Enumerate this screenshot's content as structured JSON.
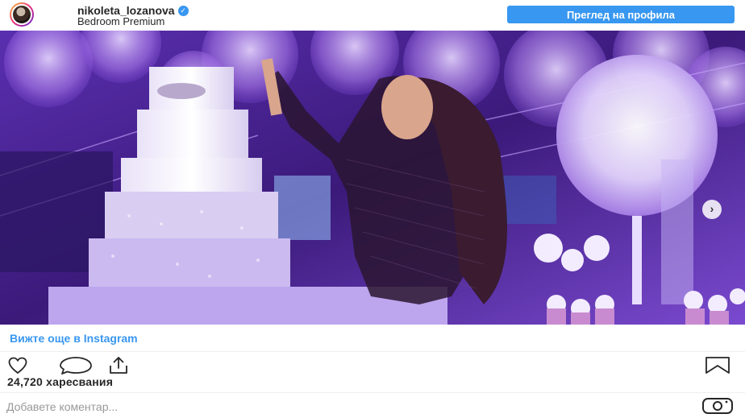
{
  "header": {
    "username": "nikoleta_lozanova",
    "verified": true,
    "location": "Bedroom Premium",
    "profile_button": "Преглед на профила"
  },
  "post": {
    "image_icon": "photo",
    "next_icon": "chevron-right-icon",
    "next_glyph": "›"
  },
  "more_link": "Вижте още в Instagram",
  "actions": {
    "like_icon": "heart-icon",
    "comment_icon": "comment-icon",
    "share_icon": "share-icon",
    "save_icon": "bookmark-icon"
  },
  "likes_text": "24,720 харесвания",
  "comment": {
    "placeholder": "Добавете коментар..."
  },
  "colors": {
    "accent": "#3897f0",
    "text": "#262626",
    "placeholder": "#999999"
  }
}
